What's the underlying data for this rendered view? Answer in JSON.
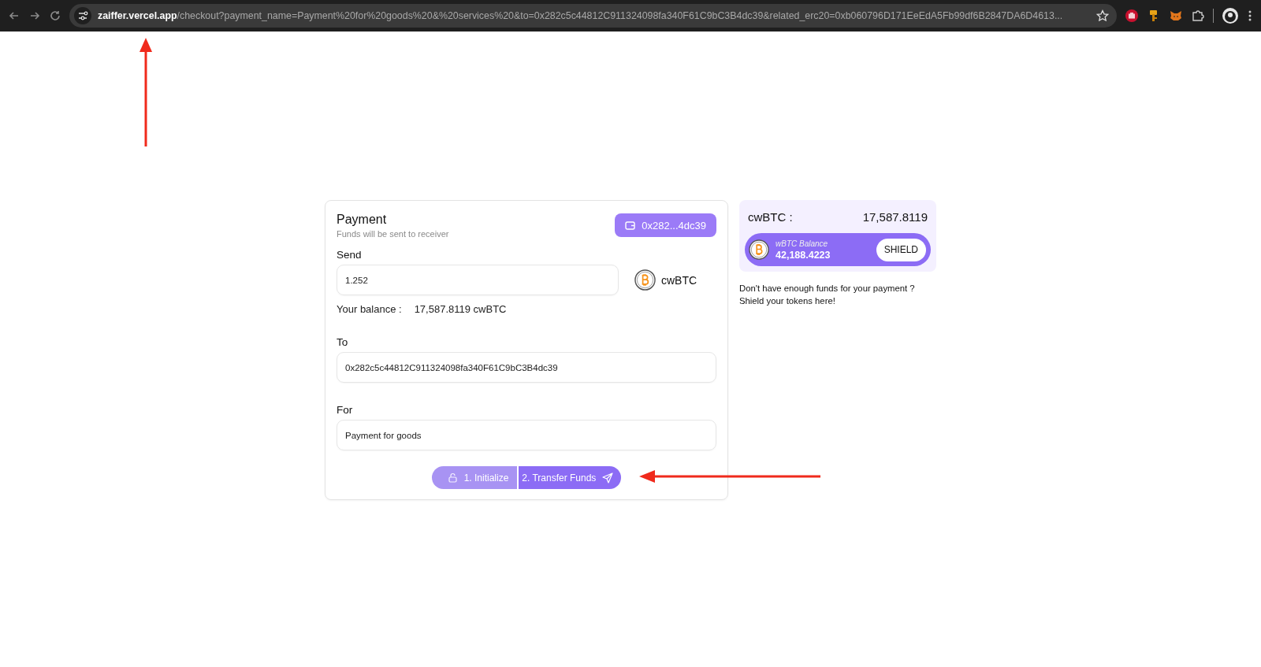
{
  "browser": {
    "url": "**zaiffer.vercel.app**/checkout?payment_name=Payment%20for%20goods%20&%20services%20&to=0x282c5c44812C911324098fa340F61C9bC3B4dc39&related_erc20=0xb060796D171EeEdA5Fb99df6B2847DA6D4613..."
  },
  "payment": {
    "title": "Payment",
    "subtitle": "Funds will be sent to receiver",
    "wallet": "0x282...4dc39",
    "send": {
      "label": "Send",
      "value": "1.252",
      "token": "cwBTC"
    },
    "balance": {
      "label": "Your balance :",
      "value": "17,587.8119 cwBTC"
    },
    "to": {
      "label": "To",
      "value": "0x282c5c44812C911324098fa340F61C9bC3B4dc39"
    },
    "for": {
      "label": "For",
      "value": "Payment for goods"
    },
    "steps": [
      {
        "label": "1. Initialize",
        "kind": "lock",
        "disabled": true
      },
      {
        "label": "2. Transfer Funds",
        "kind": "send",
        "disabled": false
      }
    ]
  },
  "side": {
    "token_label": "cwBTC :",
    "token_amount": "17,587.8119",
    "wrapped_label": "wBTC Balance",
    "wrapped_amount": "42,188.4223",
    "shield": "SHIELD",
    "hint": "Don't have enough funds for your payment ?\nShield your tokens here!"
  }
}
